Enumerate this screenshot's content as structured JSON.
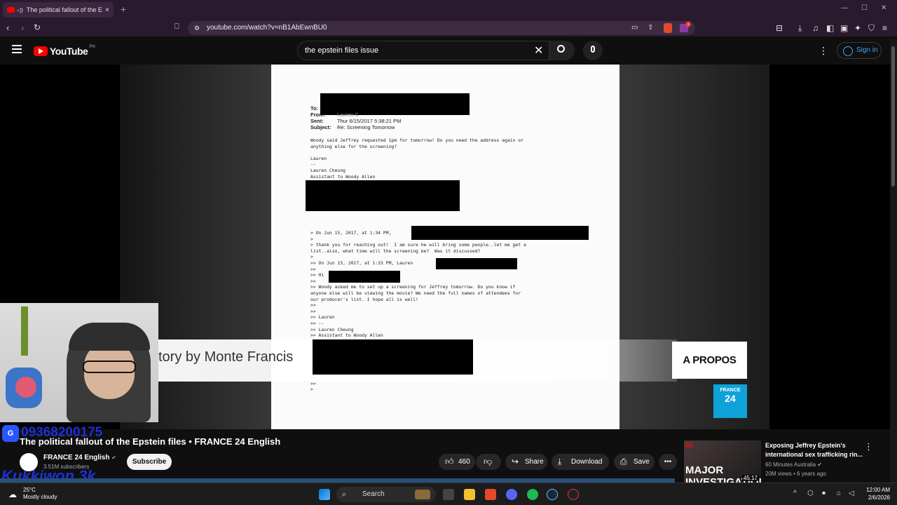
{
  "browser": {
    "tab_title": "The political fallout of the Ep",
    "tab_close": "×",
    "new_tab": "+",
    "url": "youtube.com/watch?v=nB1AbEwnBU0",
    "extension_badge": "1"
  },
  "youtube": {
    "logo_text": "YouTube",
    "logo_region": "PH",
    "search_value": "the epstein files issue",
    "sign_in": "Sign in"
  },
  "document": {
    "to_label": "To:",
    "from_label": "From:",
    "from_value": "Lauren C",
    "sent_label": "Sent:",
    "sent_value": "Thur 6/15/2017 5:38:21 PM",
    "subject_label": "Subject:",
    "subject_value": "Re: Screening Tomorrow",
    "body1": "Woody said Jeffrey requested 1pm for tomorrow! Do you need the address again or\nanything else for the screening?\n\nLauren\n--\nLauren Cheung\nAssistant to Woody Allen",
    "body2": "> On Jun 15, 2017, at 1:34 PM,\n>\n> thank you for reaching out!  I am sure he will bring some people..let me get a\nlist..also, what time will the screening be?  Was it discussed?\n>\n>> On Jun 15, 2017, at 1:33 PM, Lauren\n>>\n>> Hi\n>>\n>> Woody asked me to set up a screening for Jeffrey tomorrow. Do you know if\nanyone else will be viewing the movie? We need the full names of attendees for\nour producer's list. I hope all is well!\n>>\n>>\n>> Lauren\n>> --\n>> Lauren Cheung\n>> Assistant to Woody Allen",
    "body3": ">>\n>>\n>"
  },
  "overlay": {
    "lower_third": "tory by Monte Francis",
    "apropos": "A PROPOS",
    "france24_top": "FRANCE",
    "france24_num": "24"
  },
  "watermark": {
    "number": "09368200175",
    "name": "Kukkiwon 3k"
  },
  "video": {
    "title": "The political fallout of the Epstein files • FRANCE 24 English",
    "channel": "FRANCE 24 English",
    "subscribers": "3.51M subscribers",
    "subscribe": "Subscribe",
    "likes": "460",
    "share": "Share",
    "download": "Download",
    "save": "Save"
  },
  "recommendation": {
    "thumb_brand": "60",
    "thumb_text": "MAJOR INVESTIGATION",
    "duration": "45:17",
    "title": "Exposing Jeffrey Epstein's international sex trafficking rin...",
    "channel": "60 Minutes Australia",
    "meta": "20M views • 6 years ago"
  },
  "taskbar": {
    "temp": "25°C",
    "weather": "Mostly cloudy",
    "search": "Search",
    "time": "12:00 AM",
    "date": "2/6/2026"
  },
  "colors": {
    "browser_chrome": "#2a1a2e",
    "yt_red": "#ff0000",
    "link_blue": "#3ea6ff",
    "france24_blue": "#0fa2d8"
  }
}
